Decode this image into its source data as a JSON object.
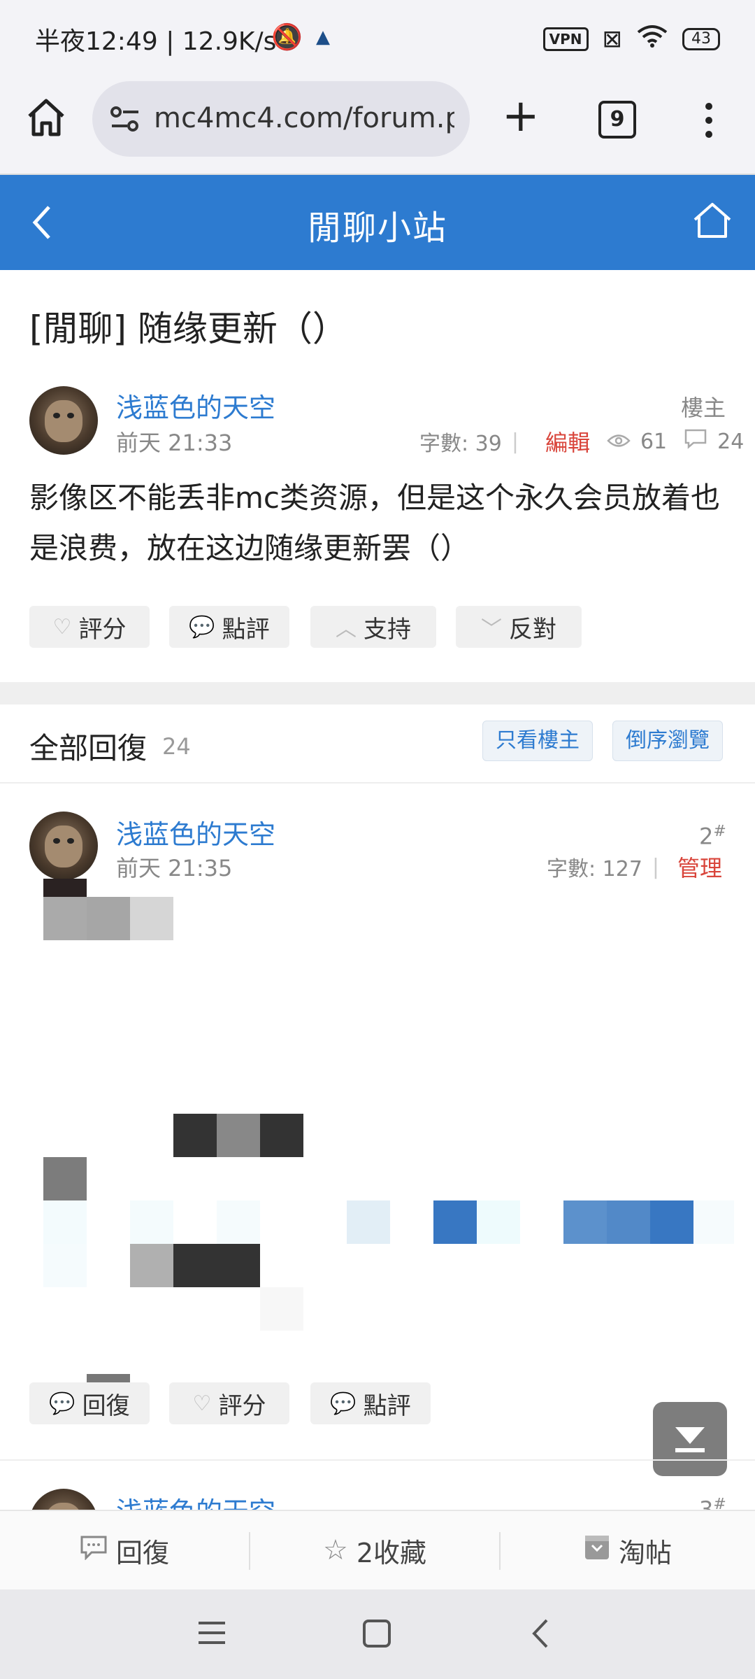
{
  "status_bar": {
    "time": "半夜12:49 | 12.9K/s",
    "vpn": "VPN",
    "battery": "43"
  },
  "browser": {
    "url": "mc4mc4.com/forum.p",
    "tab_count": "9"
  },
  "header": {
    "title": "閒聊小站"
  },
  "topic": {
    "title": "[閒聊] 随缘更新（）",
    "author": "浅蓝色的天空",
    "date": "前天 21:33",
    "role": "樓主",
    "char_count": "字數: 39",
    "edit_label": "編輯",
    "views": "61",
    "comments": "24",
    "body": "影像区不能丢非mc类资源，但是这个永久会员放着也是浪费，放在这边随缘更新罢（）",
    "actions": [
      "評分",
      "點評",
      "支持",
      "反對"
    ]
  },
  "replies": {
    "header": "全部回復",
    "count": "24",
    "filter_author": "只看樓主",
    "reverse_order": "倒序瀏覽"
  },
  "reply1": {
    "author": "浅蓝色的天空",
    "date": "前天 21:35",
    "floor": "2",
    "floor_mark": "#",
    "char_count": "字數: 127",
    "admin_label": "管理",
    "actions": [
      "回復",
      "評分",
      "點評"
    ]
  },
  "reply2": {
    "author": "浅蓝色的天空",
    "floor": "3",
    "floor_mark": "#"
  },
  "bottom_bar": {
    "reply": "回復",
    "favorite": "2收藏",
    "tao": "淘帖"
  },
  "colors": {
    "accent": "#2d7bd0",
    "danger": "#d9453b"
  }
}
